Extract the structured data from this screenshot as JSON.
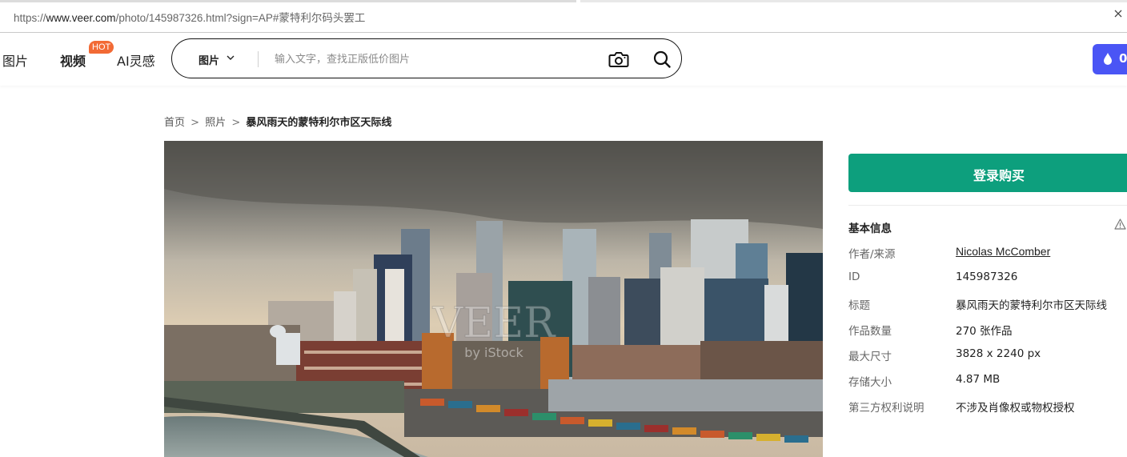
{
  "browser": {
    "url_prefix": "https://",
    "url_host": "www.veer.com",
    "url_rest": "/photo/145987326.html?sign=AP#蒙特利尔码头罢工"
  },
  "header": {
    "nav": {
      "pictures": "图片",
      "video": "视频",
      "hot_badge": "HOT",
      "ai": "AI灵感"
    },
    "search": {
      "type_label": "图片",
      "placeholder": "输入文字，查找正版低价图片"
    },
    "coin_value": "0",
    "accent_color": "#4a55f5"
  },
  "breadcrumb": {
    "home": "首页",
    "sep1": ">",
    "category": "照片",
    "sep2": ">",
    "current": "暴风雨天的蒙特利尔市区天际线"
  },
  "photo": {
    "watermark_main": "VEER",
    "watermark_sub": "by iStock"
  },
  "panel": {
    "buy_label": "登录购买",
    "buy_color": "#0d9f7d",
    "info_title": "基本信息",
    "rows": [
      {
        "key": "作者/来源",
        "value": "Nicolas McComber"
      },
      {
        "key": "ID",
        "value": "145987326"
      },
      {
        "key": "标题",
        "value": "暴风雨天的蒙特利尔市区天际线"
      },
      {
        "key": "作品数量",
        "value": "270 张作品"
      },
      {
        "key": "最大尺寸",
        "value": "3828 x 2240 px"
      },
      {
        "key": "存储大小",
        "value": "4.87 MB"
      },
      {
        "key": "第三方权利说明",
        "value": "不涉及肖像权或物权授权"
      }
    ]
  }
}
